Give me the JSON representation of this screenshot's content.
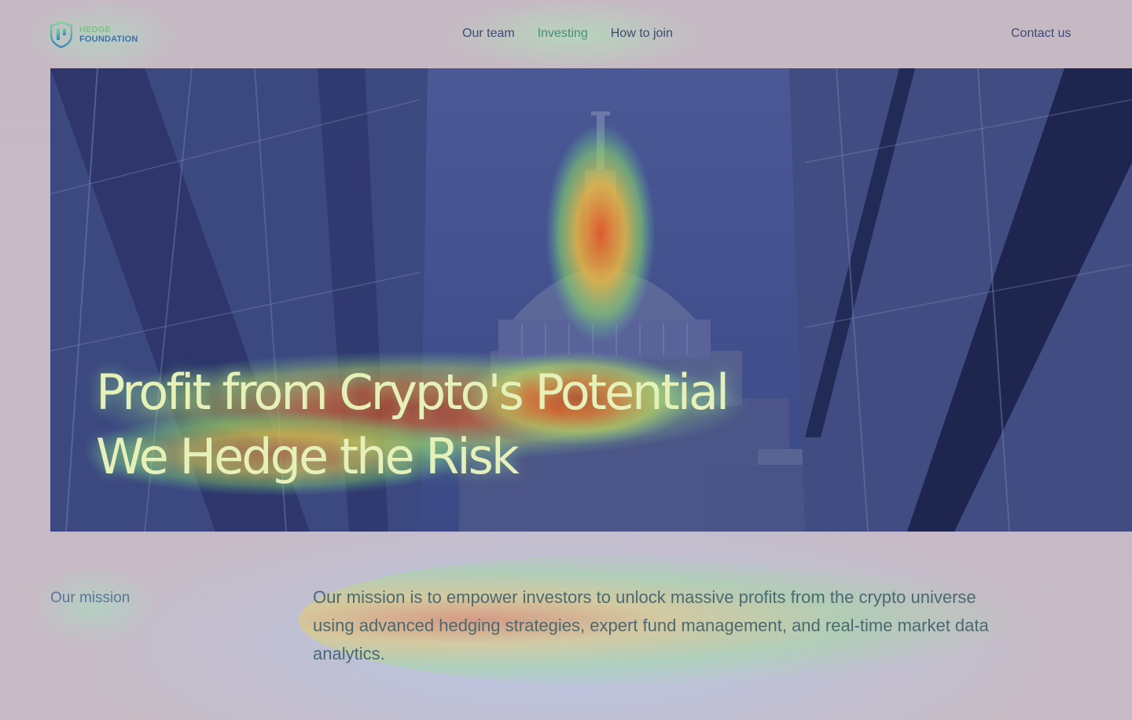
{
  "brand": {
    "name_line1": "HEDGE",
    "name_line2": "FOUNDATION",
    "logo_icon": "shield-logo-icon"
  },
  "nav": {
    "items": [
      {
        "label": "Our team",
        "active": false
      },
      {
        "label": "Investing",
        "active": true
      },
      {
        "label": "How to join",
        "active": false
      }
    ],
    "contact_label": "Contact us"
  },
  "hero": {
    "title_line1": "Profit from Crypto's Potential",
    "title_line2": "We Hedge the Risk",
    "image": "cathedral-dome-with-glass-towers"
  },
  "mission": {
    "label": "Our mission",
    "text": "Our mission is to empower investors to unlock massive profits from the crypto universe using advanced hedging strategies, expert fund management, and real-time market data analytics."
  },
  "colors": {
    "accent": "#4a8a78",
    "nav_text": "#3c4b73",
    "hero_text": "#e6f0b9",
    "background": "#c6b9c4"
  }
}
